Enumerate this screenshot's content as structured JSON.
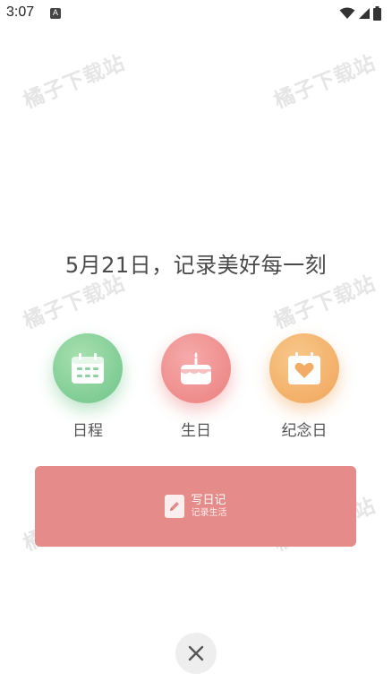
{
  "status_bar": {
    "time": "3:07",
    "app_icon_letter": "A"
  },
  "watermark": "橘子下载站",
  "headline": "5月21日，记录美好每一刻",
  "features": [
    {
      "label": "日程",
      "icon": "calendar-icon",
      "color": "#6fc48a"
    },
    {
      "label": "生日",
      "icon": "cake-icon",
      "color": "#eb7f7f"
    },
    {
      "label": "纪念日",
      "icon": "heart-calendar-icon",
      "color": "#f0a55a"
    }
  ],
  "diary": {
    "title": "写日记",
    "subtitle": "记录生活",
    "color": "#e58b89"
  },
  "close_icon": "close-icon"
}
